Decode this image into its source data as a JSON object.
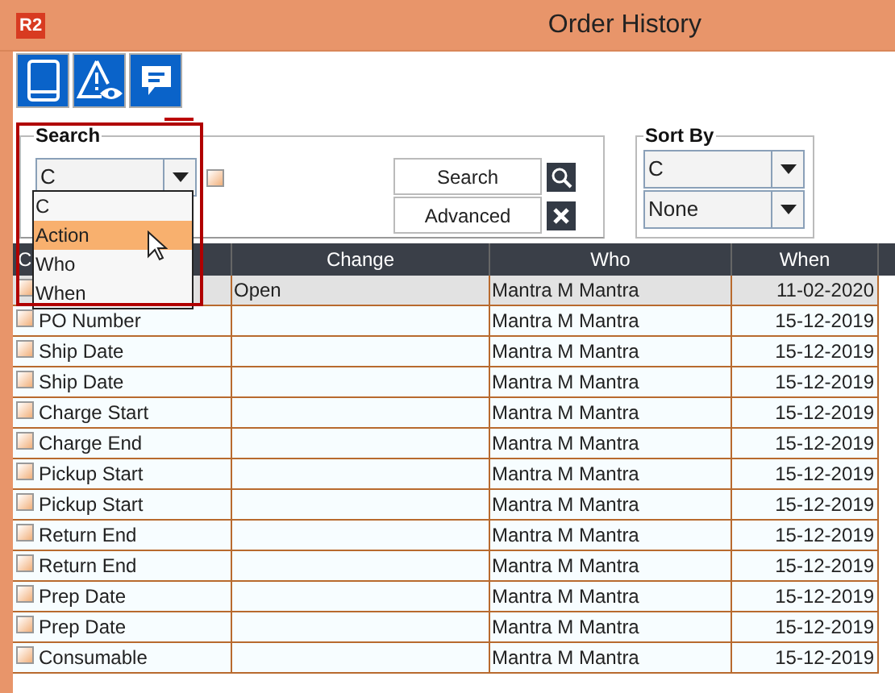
{
  "window": {
    "app_badge": "R2",
    "title": "Order History"
  },
  "search": {
    "label": "Search",
    "field": "C",
    "checked": false,
    "options": [
      {
        "label": "C",
        "selected": false
      },
      {
        "label": "Action",
        "selected": true
      },
      {
        "label": "Who",
        "selected": false
      },
      {
        "label": "When",
        "selected": false
      }
    ],
    "buttons": [
      "Search",
      "Advanced"
    ]
  },
  "sort": {
    "label": "Sort By",
    "fields": [
      "C",
      "None"
    ]
  },
  "table": {
    "columns": [
      "C",
      "Change",
      "Who",
      "When"
    ],
    "rows": [
      {
        "selected": true,
        "cells": [
          "",
          "Open",
          "Mantra M Mantra",
          "11-02-2020"
        ]
      },
      {
        "selected": false,
        "cells": [
          "PO Number",
          "",
          "Mantra M Mantra",
          "15-12-2019"
        ]
      },
      {
        "selected": false,
        "cells": [
          "Ship Date",
          "",
          "Mantra M Mantra",
          "15-12-2019"
        ]
      },
      {
        "selected": false,
        "cells": [
          "Ship Date",
          "",
          "Mantra M Mantra",
          "15-12-2019"
        ]
      },
      {
        "selected": false,
        "cells": [
          "Charge Start",
          "",
          "Mantra M Mantra",
          "15-12-2019"
        ]
      },
      {
        "selected": false,
        "cells": [
          "Charge End",
          "",
          "Mantra M Mantra",
          "15-12-2019"
        ]
      },
      {
        "selected": false,
        "cells": [
          "Pickup Start",
          "",
          "Mantra M Mantra",
          "15-12-2019"
        ]
      },
      {
        "selected": false,
        "cells": [
          "Pickup Start",
          "",
          "Mantra M Mantra",
          "15-12-2019"
        ]
      },
      {
        "selected": false,
        "cells": [
          "Return End",
          "",
          "Mantra M Mantra",
          "15-12-2019"
        ]
      },
      {
        "selected": false,
        "cells": [
          "Return End",
          "",
          "Mantra M Mantra",
          "15-12-2019"
        ]
      },
      {
        "selected": false,
        "cells": [
          "Prep Date",
          "",
          "Mantra M Mantra",
          "15-12-2019"
        ]
      },
      {
        "selected": false,
        "cells": [
          "Prep Date",
          "",
          "Mantra M Mantra",
          "15-12-2019"
        ]
      },
      {
        "selected": false,
        "cells": [
          "Consumable",
          "",
          "Mantra M Mantra",
          "15-12-2019"
        ]
      }
    ]
  }
}
